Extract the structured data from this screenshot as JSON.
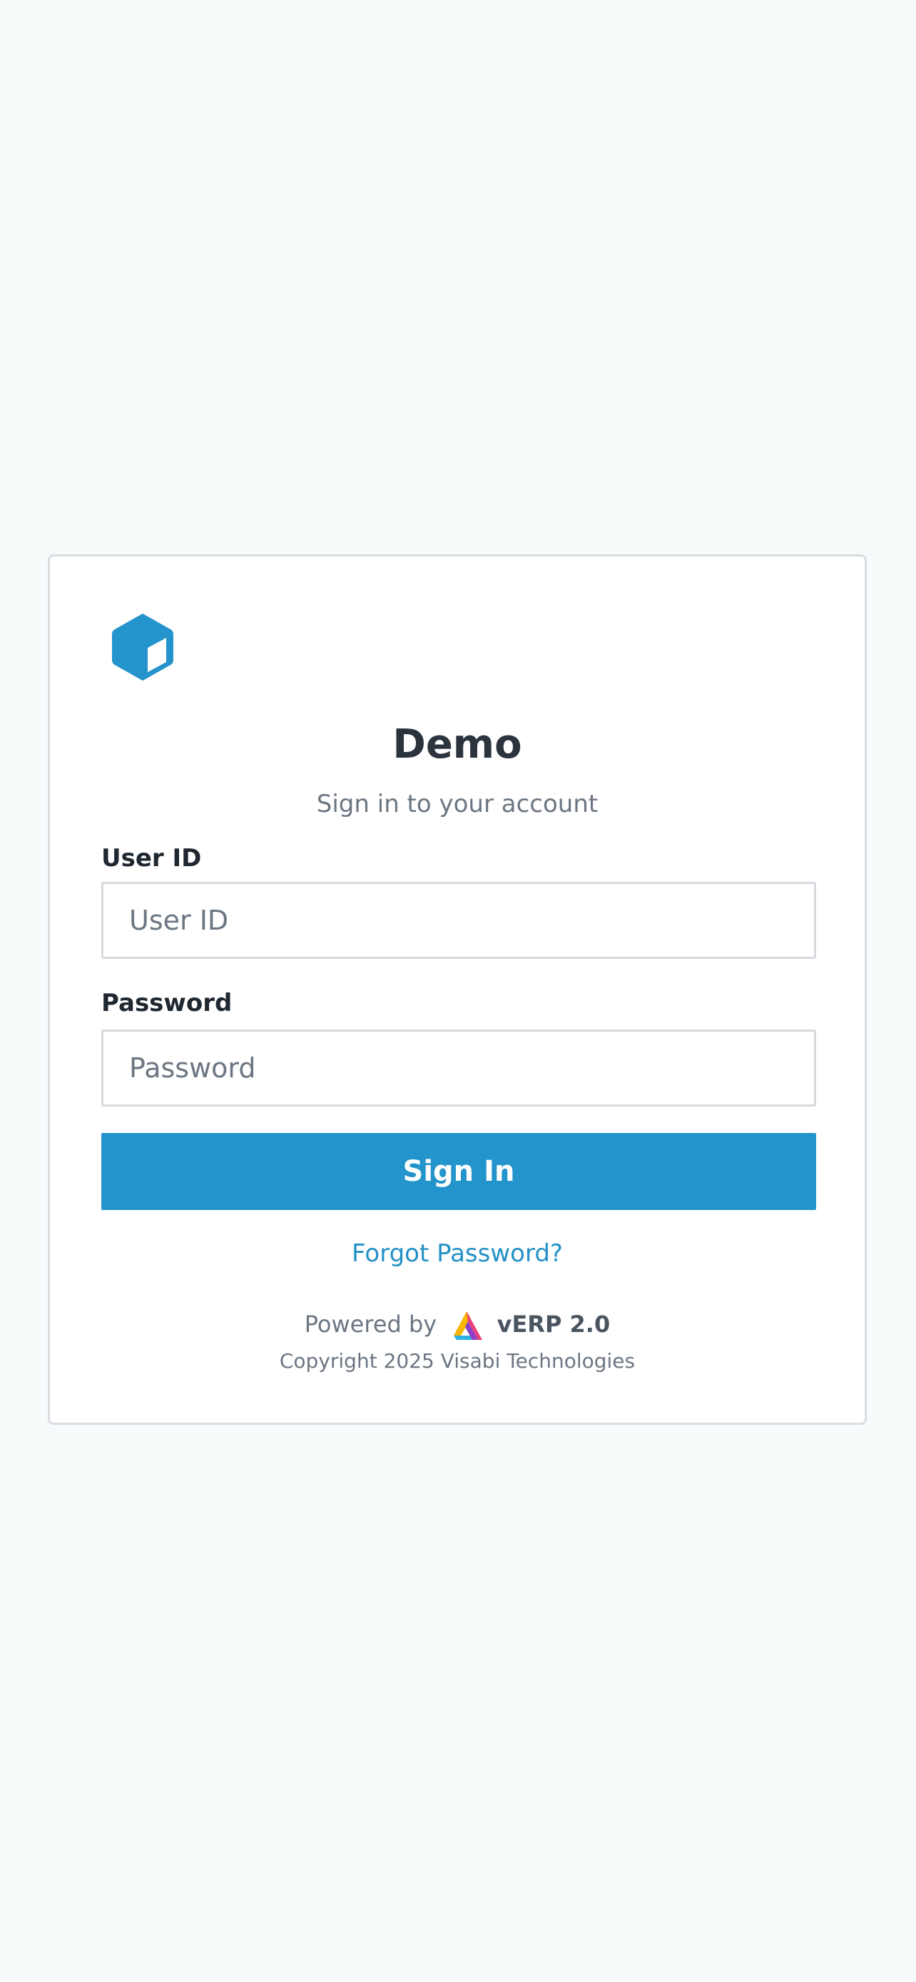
{
  "app": {
    "name": "Demo",
    "subtitle": "Sign in to your account",
    "logo_icon": "cube-icon"
  },
  "form": {
    "user_id": {
      "label": "User ID",
      "placeholder": "User ID",
      "value": ""
    },
    "password": {
      "label": "Password",
      "placeholder": "Password",
      "value": ""
    },
    "submit_label": "Sign In",
    "forgot_label": "Forgot Password?"
  },
  "footer": {
    "powered_by": "Powered by",
    "product": "vERP 2.0",
    "product_icon": "verp-triangle-logo-icon",
    "copyright": "Copyright 2025 Visabi Technologies"
  },
  "colors": {
    "page_background": "#f7fafb",
    "accent": "#2494cc",
    "link": "#2491c6",
    "heading": "#2b333d",
    "muted_text": "#6b7682"
  }
}
